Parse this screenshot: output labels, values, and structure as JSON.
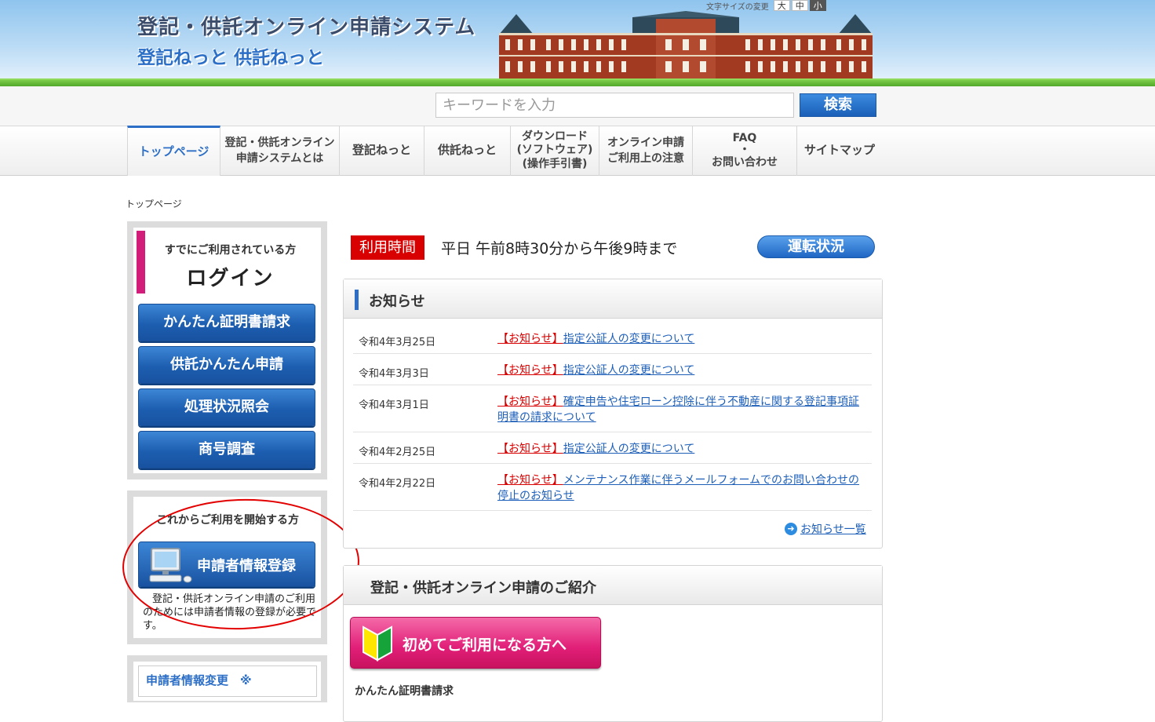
{
  "header": {
    "title": "登記・供託オンライン申請システム",
    "subtitle": "登記ねっと 供託ねっと",
    "font_size_label": "文字サイズの変更",
    "font_sizes": [
      "大",
      "中",
      "小"
    ]
  },
  "search": {
    "placeholder": "キーワードを入力",
    "button_label": "検索"
  },
  "nav": [
    {
      "label": "トップページ"
    },
    {
      "label": "登記・供託オンライン\n申請システムとは"
    },
    {
      "label": "登記ねっと"
    },
    {
      "label": "供託ねっと"
    },
    {
      "label": "ダウンロード\n(ソフトウェア)\n(操作手引書)"
    },
    {
      "label": "オンライン申請\nご利用上の注意"
    },
    {
      "label": "FAQ\n・\nお問い合わせ"
    },
    {
      "label": "サイトマップ"
    }
  ],
  "breadcrumb": "トップページ",
  "sidebar": {
    "login_caption": "すでにご利用されている方",
    "login_heading": "ログイン",
    "buttons": [
      "かんたん証明書請求",
      "供託かんたん申請",
      "処理状況照会",
      "商号調査"
    ],
    "start_caption": "これからご利用を開始する方",
    "register_button": "申請者情報登録",
    "register_note": "登記・供託オンライン申請のご利用のためには申請者情報の登録が必要です。",
    "change_title": "申請者情報変更　※"
  },
  "hours": {
    "badge": "利用時間",
    "text": "平日 午前8時30分から午後9時まで",
    "status_button": "運転状況"
  },
  "news": {
    "title": "お知らせ",
    "items": [
      {
        "date": "令和4年3月25日",
        "tag": "【お知らせ】",
        "text": "指定公証人の変更について"
      },
      {
        "date": "令和4年3月3日",
        "tag": "【お知らせ】",
        "text": "指定公証人の変更について"
      },
      {
        "date": "令和4年3月1日",
        "tag": "【お知らせ】",
        "text": "確定申告や住宅ローン控除に伴う不動産に関する登記事項証明書の請求について"
      },
      {
        "date": "令和4年2月25日",
        "tag": "【お知らせ】",
        "text": "指定公証人の変更について"
      },
      {
        "date": "令和4年2月22日",
        "tag": "【お知らせ】",
        "text": "メンテナンス作業に伴うメールフォームでのお問い合わせの停止のお知らせ"
      }
    ],
    "all_link": "お知らせ一覧"
  },
  "intro": {
    "title": "登記・供託オンライン申請のご紹介",
    "first_time_button": "初めてご利用になる方へ",
    "cut_text": "かんたん証明書請求"
  },
  "colors": {
    "accent_blue": "#2d6fc6",
    "login_pink": "#d31d7b",
    "badge_red": "#d80000",
    "annotation_red": "#e30000"
  }
}
